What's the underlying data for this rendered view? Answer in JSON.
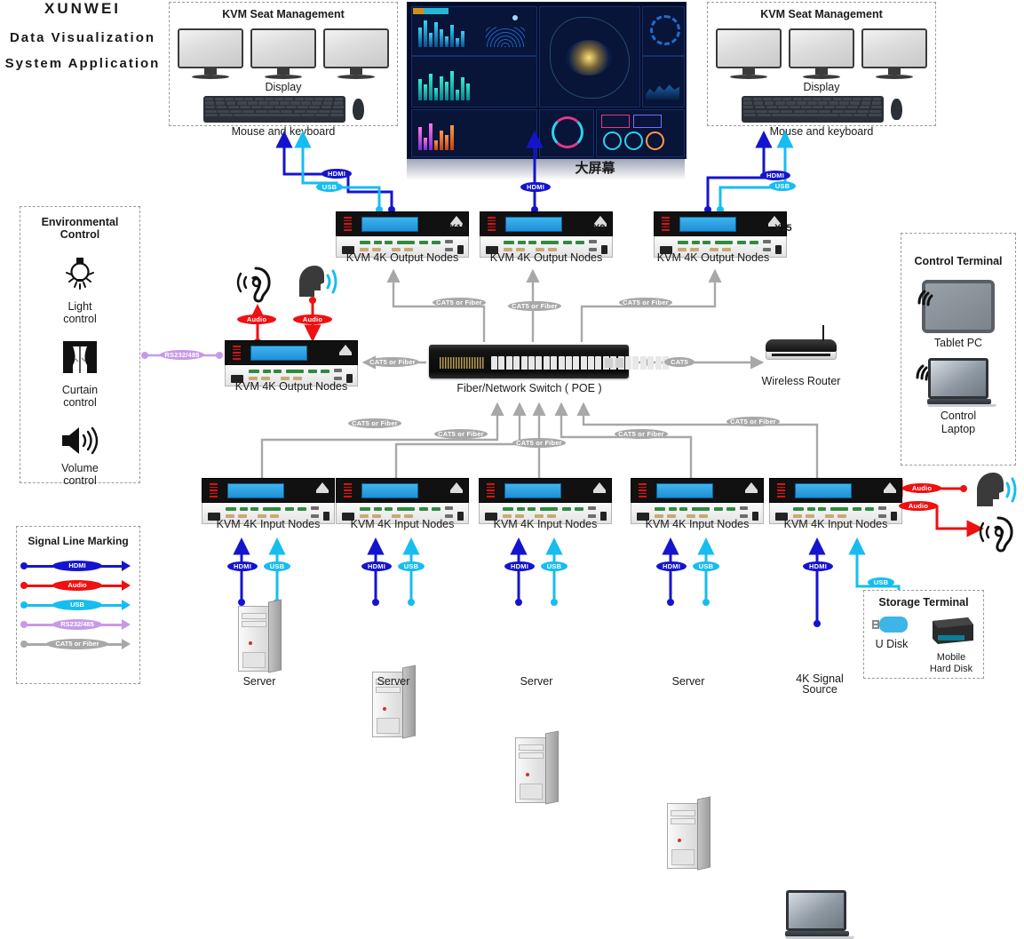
{
  "brand": {
    "line1": "XUNWEI",
    "line2": "Data Visualization",
    "line3": "System Application"
  },
  "seat_left": {
    "title": "KVM Seat Management",
    "display_label": "Display",
    "input_label": "Mouse and keyboard"
  },
  "seat_right": {
    "title": "KVM Seat Management",
    "display_label": "Display",
    "input_label": "Mouse and keyboard"
  },
  "bigscreen": {
    "caption": "大屏幕"
  },
  "environmental_control": {
    "title": "Environmental Control",
    "items": [
      {
        "label_line1": "Light",
        "label_line2": "control",
        "icon": "light-bulb-icon"
      },
      {
        "label_line1": "Curtain",
        "label_line2": "control",
        "icon": "curtain-icon"
      },
      {
        "label_line1": "Volume",
        "label_line2": "control",
        "icon": "speaker-icon"
      }
    ]
  },
  "control_terminal": {
    "title": "Control Terminal",
    "tablet_label": "Tablet PC",
    "laptop_label_line1": "Control",
    "laptop_label_line2": "Laptop"
  },
  "storage_terminal": {
    "title": "Storage Terminal",
    "udisk_label": "U Disk",
    "hdd_label_line1": "Mobile",
    "hdd_label_line2": "Hard Disk"
  },
  "switch": {
    "label": "Fiber/Network Switch ( POE )"
  },
  "router": {
    "label": "Wireless Router"
  },
  "output_nodes": [
    {
      "label": "KVM 4K Output Nodes",
      "qty": "X15"
    },
    {
      "label": "KVM 4K Output Nodes",
      "qty": "X9"
    },
    {
      "label": "KVM 4K Output Nodes",
      "qty": "X15"
    }
  ],
  "output_node_left": {
    "label": "KVM 4K Output Nodes"
  },
  "input_nodes": [
    {
      "label": "KVM 4K Input Nodes",
      "source": "Server"
    },
    {
      "label": "KVM 4K Input Nodes",
      "source": "Server"
    },
    {
      "label": "KVM 4K Input Nodes",
      "source": "Server"
    },
    {
      "label": "KVM 4K Input Nodes",
      "source": "Server"
    },
    {
      "label": "KVM 4K Input Nodes",
      "source_line1": "4K Signal",
      "source_line2": "Source"
    }
  ],
  "legend": {
    "title": "Signal Line Marking",
    "items": [
      {
        "label": "HDMI",
        "color": "#1414cf"
      },
      {
        "label": "Audio",
        "color": "#ef1010"
      },
      {
        "label": "USB",
        "color": "#17bdf0"
      },
      {
        "label": "RS232/485",
        "color": "#c79ae8"
      },
      {
        "label": "CAT5 or Fiber",
        "color": "#a8a8a8"
      }
    ]
  },
  "link_labels": {
    "hdmi": "HDMI",
    "usb": "USB",
    "audio": "Audio",
    "rs232": "RS232/485",
    "cat5_fiber": "CAT5 or Fiber",
    "cat5": "CAT5"
  },
  "colors": {
    "hdmi": "#1414cf",
    "audio": "#ef1010",
    "usb": "#17bdf0",
    "rs232": "#c79ae8",
    "cat5": "#a8a8a8",
    "screen_bg": "#050c26"
  }
}
